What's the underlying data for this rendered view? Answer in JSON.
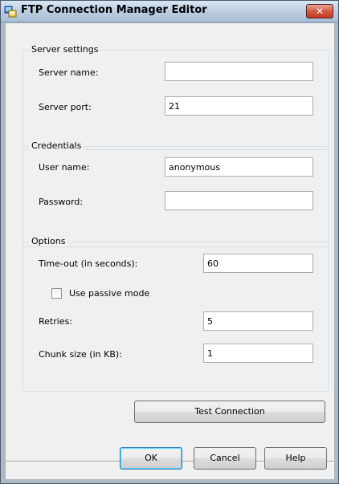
{
  "window": {
    "title": "FTP Connection Manager Editor",
    "close_glyph": "✕"
  },
  "server_settings": {
    "group_title": "Server settings",
    "server_name_label": "Server name:",
    "server_name_value": "",
    "server_port_label": "Server port:",
    "server_port_value": "21"
  },
  "credentials": {
    "group_title": "Credentials",
    "user_name_label": "User name:",
    "user_name_value": "anonymous",
    "password_label": "Password:",
    "password_value": ""
  },
  "options": {
    "group_title": "Options",
    "timeout_label": "Time-out (in seconds):",
    "timeout_value": "60",
    "passive_label": "Use passive mode",
    "passive_checked": false,
    "retries_label": "Retries:",
    "retries_value": "5",
    "chunk_label": "Chunk size (in KB):",
    "chunk_value": "1"
  },
  "buttons": {
    "test_connection": "Test Connection",
    "ok": "OK",
    "cancel": "Cancel",
    "help": "Help"
  },
  "icons": {
    "app": "ftp-connection-icon",
    "close": "close-icon"
  },
  "colors": {
    "close_button": "#d45a42",
    "titlebar": "#b9cce0",
    "default_button_border": "#3c7fb1"
  }
}
